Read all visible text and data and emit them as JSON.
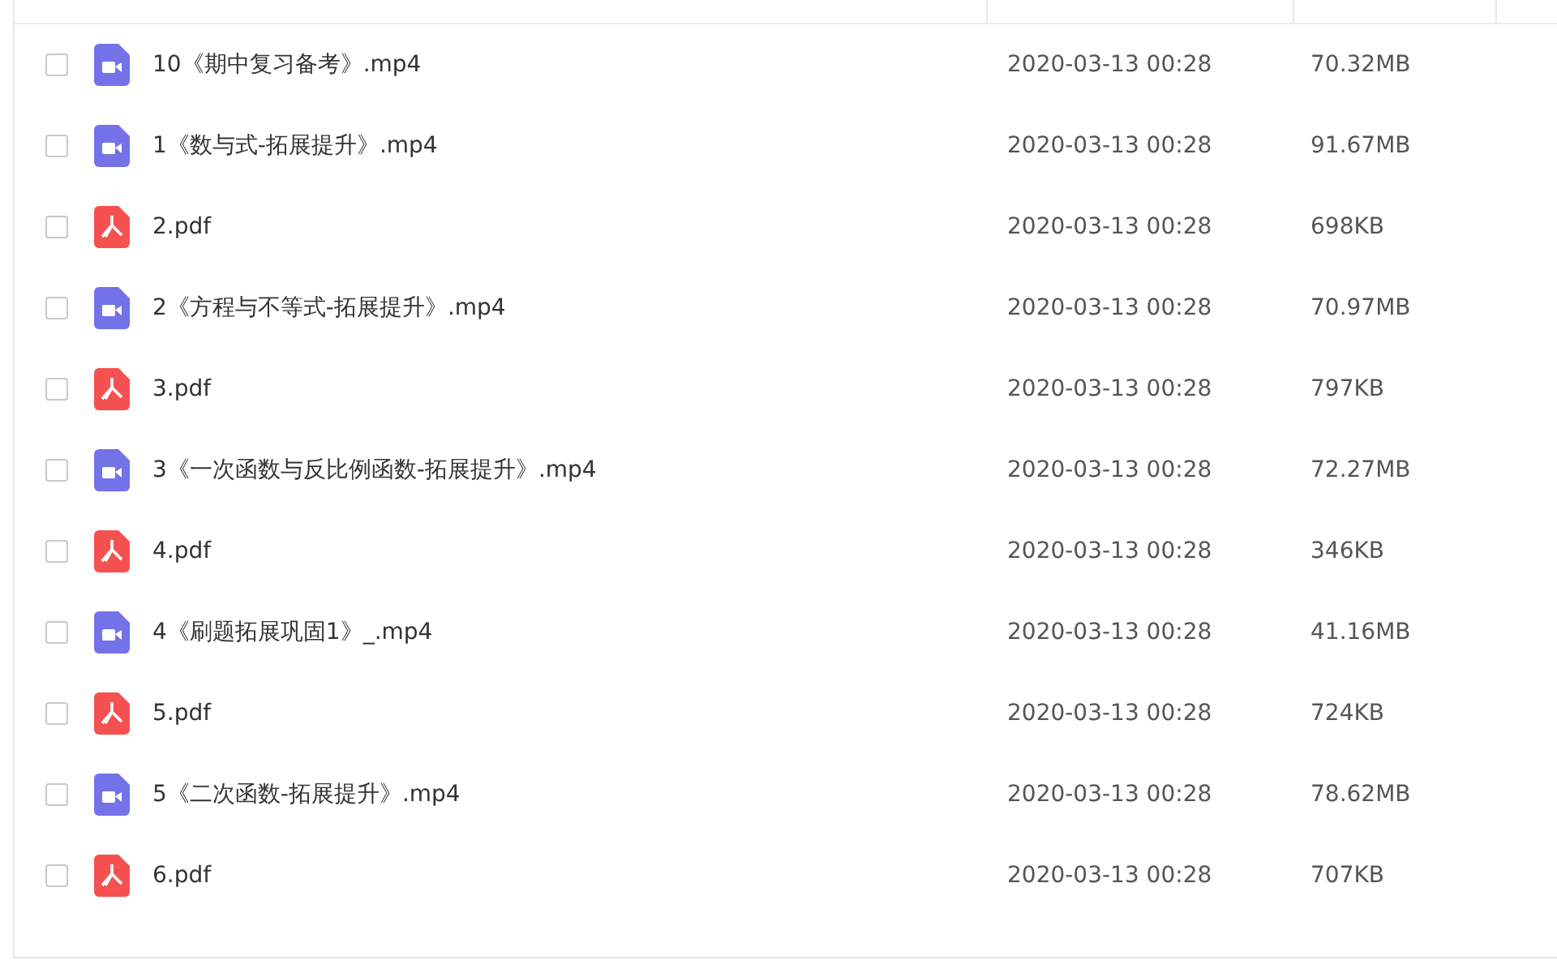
{
  "files": [
    {
      "kind": "video",
      "name": "10《期中复习备考》.mp4",
      "modified": "2020-03-13 00:28",
      "size": "70.32MB",
      "checked": false
    },
    {
      "kind": "video",
      "name": "1《数与式-拓展提升》.mp4",
      "modified": "2020-03-13 00:28",
      "size": "91.67MB",
      "checked": false
    },
    {
      "kind": "pdf",
      "name": "2.pdf",
      "modified": "2020-03-13 00:28",
      "size": "698KB",
      "checked": false
    },
    {
      "kind": "video",
      "name": "2《方程与不等式-拓展提升》.mp4",
      "modified": "2020-03-13 00:28",
      "size": "70.97MB",
      "checked": false
    },
    {
      "kind": "pdf",
      "name": "3.pdf",
      "modified": "2020-03-13 00:28",
      "size": "797KB",
      "checked": false
    },
    {
      "kind": "video",
      "name": "3《一次函数与反比例函数-拓展提升》.mp4",
      "modified": "2020-03-13 00:28",
      "size": "72.27MB",
      "checked": false
    },
    {
      "kind": "pdf",
      "name": "4.pdf",
      "modified": "2020-03-13 00:28",
      "size": "346KB",
      "checked": false
    },
    {
      "kind": "video",
      "name": "4《刷题拓展巩固1》_.mp4",
      "modified": "2020-03-13 00:28",
      "size": "41.16MB",
      "checked": false
    },
    {
      "kind": "pdf",
      "name": "5.pdf",
      "modified": "2020-03-13 00:28",
      "size": "724KB",
      "checked": false
    },
    {
      "kind": "video",
      "name": "5《二次函数-拓展提升》.mp4",
      "modified": "2020-03-13 00:28",
      "size": "78.62MB",
      "checked": false
    },
    {
      "kind": "pdf",
      "name": "6.pdf",
      "modified": "2020-03-13 00:28",
      "size": "707KB",
      "checked": false
    }
  ]
}
